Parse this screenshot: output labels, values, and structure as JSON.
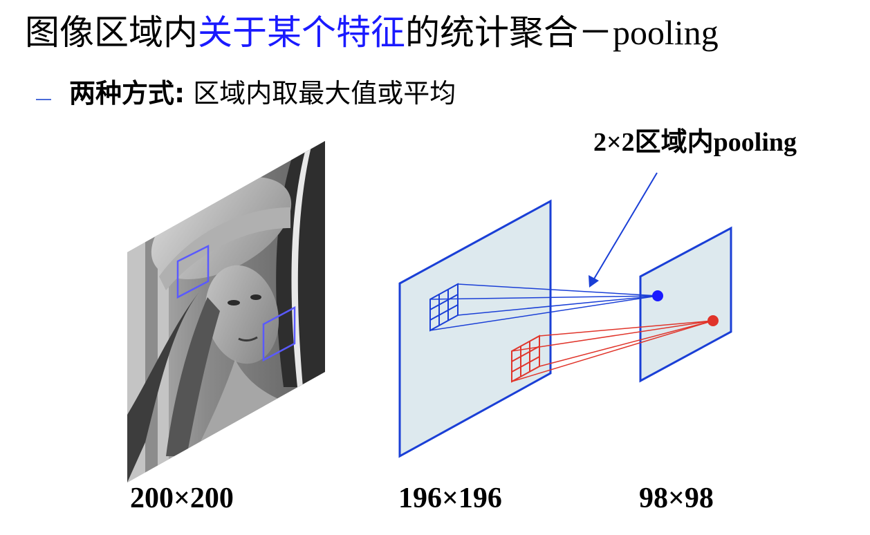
{
  "title": {
    "part1": "图像区域内",
    "part2": "关于某个特征",
    "part3": "的统计聚合",
    "part4": "－pooling"
  },
  "bullet": {
    "bold": "两种方式:",
    "text": " 区域内取最大值或平均"
  },
  "annotation": {
    "pool_label": "2×2区域内pooling"
  },
  "sizes": {
    "input": "200×200",
    "feature": "196×196",
    "pooled": "98×98"
  },
  "colors": {
    "blue": "#1a3fd6",
    "red": "#e0342a",
    "plane_fill": "#dde9ee",
    "title_highlight": "#1a1aff"
  }
}
